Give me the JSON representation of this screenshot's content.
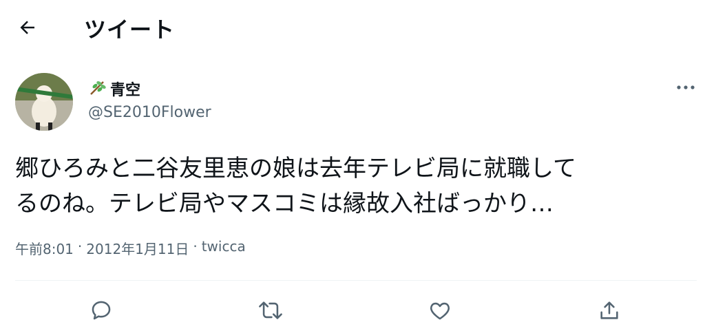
{
  "header": {
    "title": "ツイート",
    "back_icon": "arrow-left-icon"
  },
  "user": {
    "name": "青空",
    "emoji_icon": "herb-icon",
    "handle": "@SE2010Flower"
  },
  "tweet": {
    "line1": "郷ひろみと二谷友里恵の娘は去年テレビ局に就職して",
    "line2": "るのね。テレビ局やマスコミは縁故入社ばっかり…"
  },
  "meta": {
    "time": "午前8:01",
    "sep1": "·",
    "date": "2012年1月11日",
    "sep2": "·",
    "source": "twicca"
  },
  "actions": [
    "reply-icon",
    "retweet-icon",
    "like-icon",
    "share-icon"
  ],
  "colors": {
    "text": "#0f1419",
    "secondary": "#536471",
    "divider": "#eff3f4"
  }
}
